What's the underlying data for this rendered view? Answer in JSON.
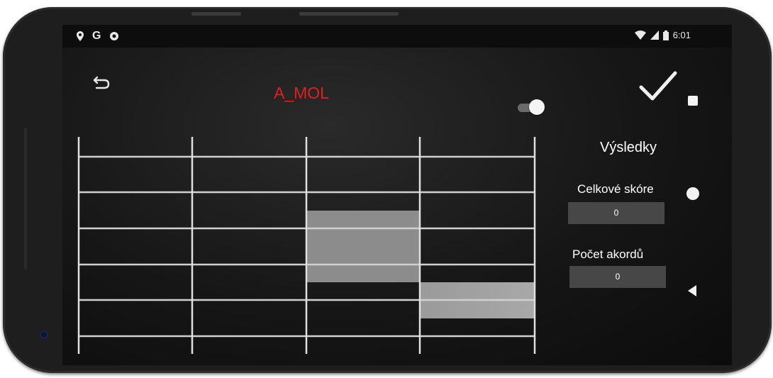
{
  "status_bar": {
    "left_icons": [
      "location-icon",
      "google-icon",
      "settings-icon"
    ],
    "right_icons": [
      "wifi-icon",
      "signal-icon",
      "battery-icon"
    ],
    "time": "6:01"
  },
  "header": {
    "title": "A_MOL",
    "title_color": "#e02020",
    "back_icon": "undo-icon",
    "confirm_icon": "check-icon",
    "toggle_on": true
  },
  "fretboard": {
    "strings": 6,
    "frets": 5,
    "highlighted_cells": [
      {
        "fret": 3,
        "rows": [
          2,
          3
        ]
      },
      {
        "fret": 4,
        "row": 4
      }
    ],
    "highlight_color": "#8c8c8c"
  },
  "results": {
    "title": "Výsledky",
    "total_score_label": "Celkové skóre",
    "total_score_value": "0",
    "chord_count_label": "Počet akordů",
    "chord_count_value": "0"
  },
  "nav_bar": {
    "icons": [
      "recents-icon",
      "home-icon",
      "back-icon"
    ]
  }
}
